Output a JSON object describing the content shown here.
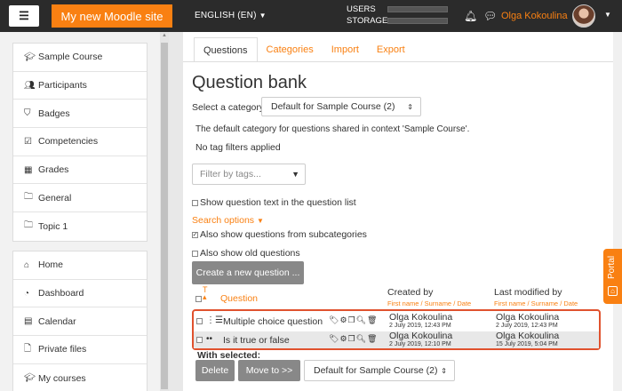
{
  "topbar": {
    "site_name": "My new Moodle site",
    "language": "ENGLISH (EN)",
    "usage": [
      {
        "label": "USERS",
        "fraction": 0.0
      },
      {
        "label": "STORAGE",
        "fraction": 0.0
      }
    ],
    "username": "Olga Kokoulina"
  },
  "sidebar": {
    "course_items": [
      {
        "label": "Sample Course",
        "icon": "graduation-cap-icon"
      },
      {
        "label": "Participants",
        "icon": "users-icon"
      },
      {
        "label": "Badges",
        "icon": "shield-icon"
      },
      {
        "label": "Competencies",
        "icon": "checkbox-icon"
      },
      {
        "label": "Grades",
        "icon": "table-icon"
      },
      {
        "label": "General",
        "icon": "folder-icon"
      },
      {
        "label": "Topic 1",
        "icon": "folder-icon"
      }
    ],
    "site_items": [
      {
        "label": "Home",
        "icon": "home-icon"
      },
      {
        "label": "Dashboard",
        "icon": "dashboard-icon"
      },
      {
        "label": "Calendar",
        "icon": "calendar-icon"
      },
      {
        "label": "Private files",
        "icon": "file-icon"
      },
      {
        "label": "My courses",
        "icon": "graduation-cap-icon"
      }
    ]
  },
  "tabs": [
    "Questions",
    "Categories",
    "Import",
    "Export"
  ],
  "page": {
    "title": "Question bank",
    "category_label": "Select a category:",
    "category_value": "Default for Sample Course (2)",
    "category_desc": "The default category for questions shared in context 'Sample Course'.",
    "no_tag": "No tag filters applied",
    "filter_placeholder": "Filter by tags...",
    "show_text_label": "Show question text in the question list",
    "search_options": "Search options",
    "subcat_label": "Also show questions from subcategories",
    "old_label": "Also show old questions",
    "create_button": "Create a new question ..."
  },
  "table": {
    "sort_label": "T",
    "question_header": "Question",
    "created_header": "Created by",
    "created_sub": "First name / Surname / Date",
    "modified_header": "Last modified by",
    "modified_sub": "First name / Surname / Date",
    "rows": [
      {
        "name": "Multiple choice question",
        "type_icon": "list-icon",
        "created_by": "Olga Kokoulina",
        "created_date": "2 July 2019, 12:43 PM",
        "modified_by": "Olga Kokoulina",
        "modified_date": "2 July 2019, 12:43 PM"
      },
      {
        "name": "Is it true or false",
        "type_icon": "dots-icon",
        "created_by": "Olga Kokoulina",
        "created_date": "2 July 2019, 12:10 PM",
        "modified_by": "Olga Kokoulina",
        "modified_date": "15 July 2019, 5:04 PM"
      }
    ]
  },
  "bulk": {
    "with_selected": "With selected:",
    "delete": "Delete",
    "move_to": "Move to >>",
    "move_target": "Default for Sample Course (2)"
  },
  "portal_label": "Portal",
  "colors": {
    "accent": "#f98012",
    "highlight_border": "#e0522e",
    "topbar": "#2b2b2b"
  }
}
